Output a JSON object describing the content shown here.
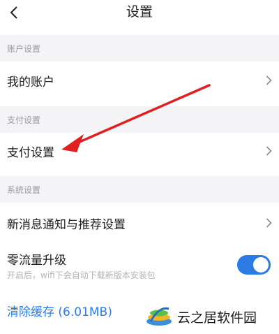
{
  "header": {
    "title": "设置",
    "back_icon": "chevron-left-icon"
  },
  "sections": {
    "account": {
      "label": "账户设置",
      "items": [
        {
          "label": "我的账户"
        }
      ]
    },
    "payment": {
      "label": "支付设置",
      "items": [
        {
          "label": "支付设置"
        }
      ]
    },
    "system": {
      "label": "系统设置",
      "items": [
        {
          "label": "新消息通知与推荐设置"
        }
      ],
      "zero_traffic": {
        "title": "零流量升级",
        "subtitle": "开启后，wifi下会自动下载新版本安装包",
        "enabled": true
      }
    }
  },
  "clear_cache": {
    "label": "清除缓存 (6.01MB)"
  },
  "watermark": {
    "text": "云之居软件园"
  },
  "colors": {
    "accent": "#2c7be5",
    "annotation": "#e02020",
    "section_bg": "#f4f4f6"
  }
}
